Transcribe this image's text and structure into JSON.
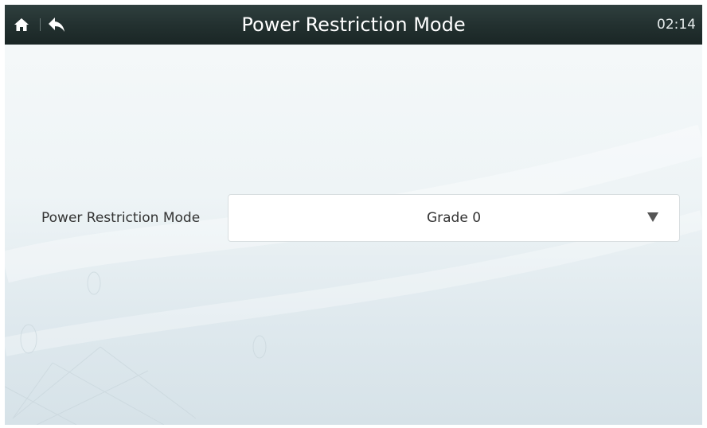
{
  "header": {
    "title": "Power Restriction Mode",
    "time": "02:14",
    "icons": {
      "home": "home-icon",
      "back": "back-arrow-icon"
    }
  },
  "settings": {
    "label": "Power Restriction Mode",
    "selected_value": "Grade 0"
  },
  "colors": {
    "titlebar": "#233130",
    "title_text": "#ffffff",
    "label_text": "#333333",
    "background": "#eef4f6"
  }
}
